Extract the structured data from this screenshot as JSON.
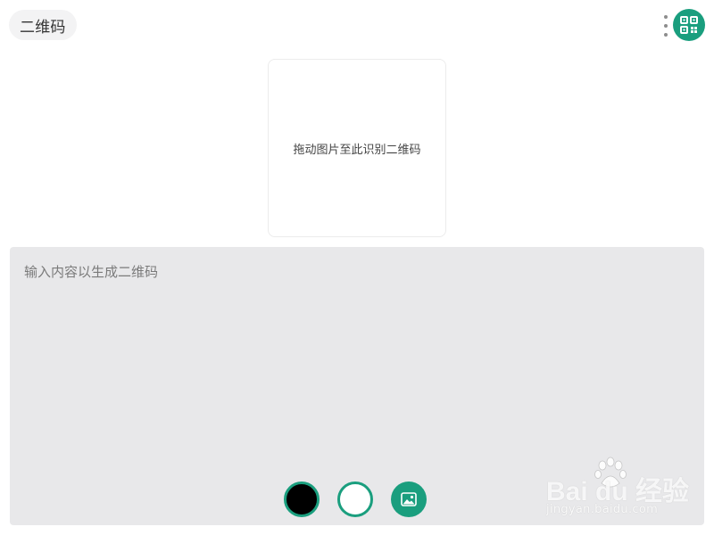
{
  "header": {
    "title": "二维码",
    "more_icon": "more-vertical-icon",
    "app_icon": "qr-code-icon"
  },
  "drop_zone": {
    "text": "拖动图片至此识别二维码"
  },
  "input": {
    "placeholder": "输入内容以生成二维码",
    "value": ""
  },
  "controls": {
    "foreground_color": "#000000",
    "background_color": "#ffffff",
    "logo_icon": "image-icon"
  },
  "watermark": {
    "brand": "Bai du 经验",
    "url": "jingyan.baidu.com"
  },
  "colors": {
    "accent": "#1a9e7e",
    "input_bg": "#e8e8ea",
    "chip_bg": "#f3f3f4"
  }
}
